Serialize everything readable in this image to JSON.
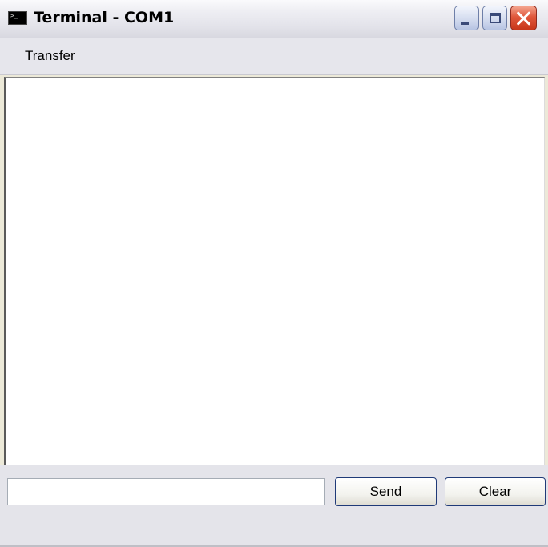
{
  "window": {
    "title": "Terminal - COM1",
    "icon": "terminal-icon",
    "controls": {
      "minimize": "minimize-icon",
      "maximize": "maximize-icon",
      "close": "close-icon"
    }
  },
  "menu": {
    "items": [
      {
        "label": "Transfer"
      }
    ]
  },
  "output": {
    "text": ""
  },
  "input": {
    "value": "",
    "placeholder": ""
  },
  "buttons": {
    "send_label": "Send",
    "clear_label": "Clear"
  },
  "colors": {
    "close_button": "#e0573b",
    "button_border": "#1f3a78",
    "window_background": "#e4e4ea"
  }
}
